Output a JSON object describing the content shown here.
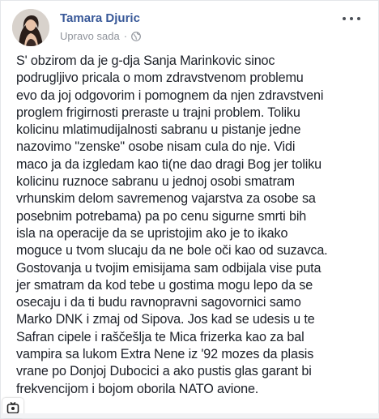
{
  "post": {
    "author": "Tamara Djuric",
    "timestamp": "Upravo sada",
    "separator": "·",
    "audience_icon": "globe-icon",
    "menu_icon": "more-options-icon",
    "lines": [
      "S' obzirom da je g-dja Sanja Marinkovic sinoc",
      "podrugljivo pricala o mom zdravstvenom problemu",
      "evo da joj odgovorim i pomognem da njen zdravstveni",
      "proglem frigirnosti preraste u trajni problem.  Toliku",
      "kolicinu mlatimudijalnosti sabranu u pistanje jedne",
      "nazovimo \"zenske\" osobe nisam cula do nje.  Vidi",
      "maco ja da izgledam kao ti(ne dao dragi Bog jer toliku",
      "kolicinu ruznoce sabranu u jednoj osobi smatram",
      "vrhunskim delom savremenog vajarstva za osobe sa",
      "posebnim potrebama) pa po cenu sigurne smrti bih",
      "isla na operacije da se upristojim ako je to ikako",
      "moguce u tvom slucaju da ne bole oči kao od suzavca.",
      "Gostovanja u tvojim emisijama sam odbijala vise puta",
      "jer smatram da kod tebe u gostima mogu lepo da se",
      "osecaju i da ti budu ravnopravni sagovornici samo",
      "Marko DNK i zmaj od Sipova. Jos kad se udesis u te",
      "Safran cipele i raščešlja te Mica frizerka kao za bal",
      "vampira sa lukom Extra Nene iz '92 mozes da plasis",
      "vrane po Donjoj Dubocici a ako pustis glas garant bi",
      "frekvencijom i bojom oborila NATO avione."
    ]
  },
  "colors": {
    "author_name": "#385898",
    "meta_text": "#90949c",
    "body_text": "#1d2129"
  }
}
